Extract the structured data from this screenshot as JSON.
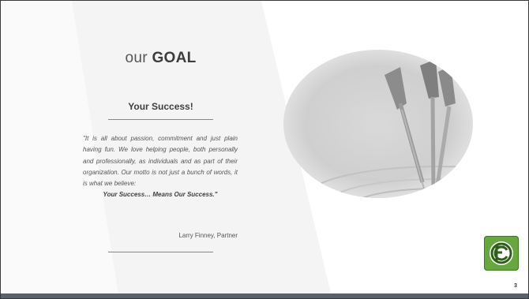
{
  "slide": {
    "title_light": "our",
    "title_bold": "GOAL",
    "subtitle": "Your Success!",
    "quote_lines": [
      "\"It is all about passion, commitment and just plain having fun.  We love helping people, both personally and professionally, as individuals and as part of their organization. Our motto is not just a bunch of words, it is what we believe:"
    ],
    "tagline": "Your Success… Means Our Success.\"",
    "attribution": "Larry Finney, Partner",
    "page_number": "3",
    "logo_text": "FC"
  },
  "colors": {
    "accent_green": "#6ea33c",
    "logo_green": "#67a83e",
    "bottom_bar": "#5d6167",
    "text": "#555555"
  },
  "icons": {
    "photo": "darts-in-dartboard-photo",
    "logo": "fc-logo-icon"
  }
}
